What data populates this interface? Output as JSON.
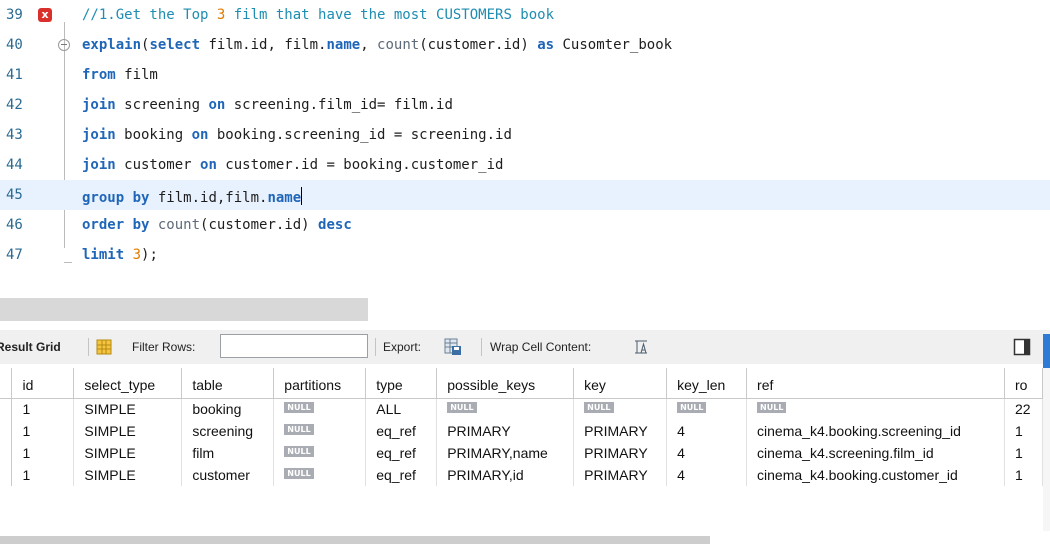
{
  "editor": {
    "lines": [
      {
        "num": "39",
        "parts": [
          [
            "cmt",
            "//1.Get the Top "
          ],
          [
            "num",
            "3"
          ],
          [
            "cmt",
            " film that have the most CUSTOMERS book"
          ]
        ]
      },
      {
        "num": "40",
        "parts": [
          [
            "kw",
            "explain"
          ],
          [
            "",
            "("
          ],
          [
            "kw",
            "select"
          ],
          [
            "",
            " film.id, film."
          ],
          [
            "kw",
            "name"
          ],
          [
            "",
            ", "
          ],
          [
            "fn",
            "count"
          ],
          [
            "",
            "(customer.id) "
          ],
          [
            "kw",
            "as"
          ],
          [
            "",
            " Cusomter_book"
          ]
        ]
      },
      {
        "num": "41",
        "parts": [
          [
            "kw",
            "from"
          ],
          [
            "",
            " film"
          ]
        ]
      },
      {
        "num": "42",
        "parts": [
          [
            "kw",
            "join"
          ],
          [
            "",
            " screening "
          ],
          [
            "kw",
            "on"
          ],
          [
            "",
            " screening.film_id= film.id"
          ]
        ]
      },
      {
        "num": "43",
        "parts": [
          [
            "kw",
            "join"
          ],
          [
            "",
            " booking "
          ],
          [
            "kw",
            "on"
          ],
          [
            "",
            " booking.screening_id = screening.id"
          ]
        ]
      },
      {
        "num": "44",
        "parts": [
          [
            "kw",
            "join"
          ],
          [
            "",
            " customer "
          ],
          [
            "kw",
            "on"
          ],
          [
            "",
            " customer.id = booking.customer_id"
          ]
        ]
      },
      {
        "num": "45",
        "parts": [
          [
            "kw",
            "group by"
          ],
          [
            "",
            " film.id,film."
          ],
          [
            "kw",
            "name"
          ]
        ]
      },
      {
        "num": "46",
        "parts": [
          [
            "kw",
            "order by"
          ],
          [
            "",
            " "
          ],
          [
            "fn",
            "count"
          ],
          [
            "",
            "(customer.id) "
          ],
          [
            "kw",
            "desc"
          ]
        ]
      },
      {
        "num": "47",
        "parts": [
          [
            "kw",
            "limit"
          ],
          [
            "",
            " "
          ],
          [
            "num",
            "3"
          ],
          [
            "",
            ");"
          ]
        ]
      }
    ],
    "error_mark": "x",
    "current_line": "45"
  },
  "toolbar": {
    "result_grid": "Result Grid",
    "filter_rows": "Filter Rows:",
    "filter_value": "",
    "export": "Export:",
    "wrap": "Wrap Cell Content:"
  },
  "grid": {
    "columns": [
      "id",
      "select_type",
      "table",
      "partitions",
      "type",
      "possible_keys",
      "key",
      "key_len",
      "ref",
      "ro"
    ],
    "rows": [
      [
        "1",
        "SIMPLE",
        "booking",
        "NULL",
        "ALL",
        "NULL",
        "NULL",
        "NULL",
        "NULL",
        "22"
      ],
      [
        "1",
        "SIMPLE",
        "screening",
        "NULL",
        "eq_ref",
        "PRIMARY",
        "PRIMARY",
        "4",
        "cinema_k4.booking.screening_id",
        "1"
      ],
      [
        "1",
        "SIMPLE",
        "film",
        "NULL",
        "eq_ref",
        "PRIMARY,name",
        "PRIMARY",
        "4",
        "cinema_k4.screening.film_id",
        "1"
      ],
      [
        "1",
        "SIMPLE",
        "customer",
        "NULL",
        "eq_ref",
        "PRIMARY,id",
        "PRIMARY",
        "4",
        "cinema_k4.booking.customer_id",
        "1"
      ]
    ],
    "null_token": "NULL"
  },
  "colors": {
    "keyword": "#1f66b8",
    "number": "#e07b00",
    "error": "#d9302c",
    "accent": "#2e7bd6"
  }
}
